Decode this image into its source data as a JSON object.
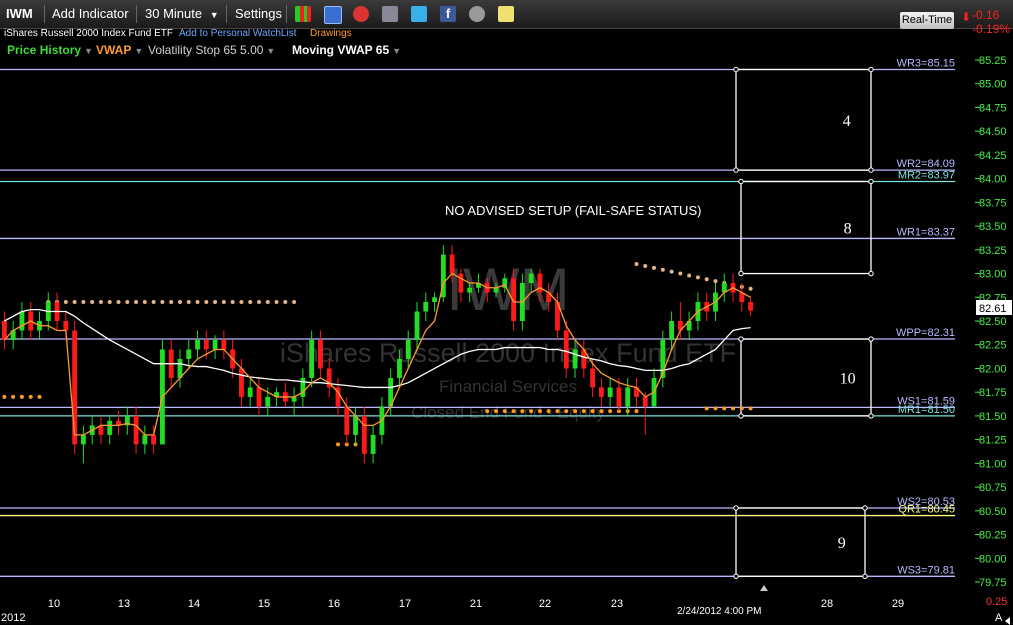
{
  "toolbar": {
    "symbol": "IWM",
    "add_indicator": "Add Indicator",
    "interval": "30 Minute",
    "settings": "Settings",
    "realtime_label": "Real-Time",
    "change": "-0.16",
    "change_pct": "-0.19%"
  },
  "subtitle": "iShares Russell 2000 Index Fund ETF",
  "watchlist_link": "Add to Personal WatchList",
  "drawings_link": "Drawings",
  "legend": [
    {
      "label": "Price History",
      "color": "#3cdc3c"
    },
    {
      "label": "VWAP",
      "color": "#ff9a30"
    },
    {
      "label": "Volatility Stop 65 5.00",
      "color": "#d0d0d0"
    },
    {
      "label": "Moving VWAP 65",
      "color": "#ffffff"
    }
  ],
  "annotation": "NO ADVISED SETUP (FAIL-SAFE STATUS)",
  "watermark": {
    "symbol": "IWM",
    "name": "iShares Russell 2000 Index Fund ETF",
    "sector": "Financial Services",
    "industry": "Closed End Fund - Equity"
  },
  "chart_data": {
    "type": "candlestick",
    "ylim": [
      79.75,
      85.25
    ],
    "y_ticks": [
      "85.25",
      "85.00",
      "84.75",
      "84.50",
      "84.25",
      "84.00",
      "83.75",
      "83.50",
      "83.25",
      "83.00",
      "82.75",
      "82.50",
      "82.25",
      "82.00",
      "81.75",
      "81.50",
      "81.25",
      "81.00",
      "80.75",
      "80.50",
      "80.25",
      "80.00",
      "79.75"
    ],
    "y_tick_step": 0.25,
    "x_labels": [
      "10",
      "13",
      "14",
      "15",
      "16",
      "17",
      "21",
      "22",
      "23",
      "28",
      "29"
    ],
    "last_bar_time": "2/24/2012 4:00 PM",
    "year_label": "2012",
    "last_price": "82.61",
    "last_price_value": 82.61,
    "scale_flag": "0.25",
    "scale_mode": "A",
    "pivot_levels": [
      {
        "label": "WR3=85.15",
        "value": 85.15,
        "color": "#b9b9ff"
      },
      {
        "label": "WR2=84.09",
        "value": 84.09,
        "color": "#b9b9ff"
      },
      {
        "label": "MR2=83.97",
        "value": 83.97,
        "color": "#7fe0e0"
      },
      {
        "label": "WR1=83.37",
        "value": 83.37,
        "color": "#b9b9ff"
      },
      {
        "label": "WPP=82.31",
        "value": 82.31,
        "color": "#b9b9ff"
      },
      {
        "label": "WS1=81.59",
        "value": 81.59,
        "color": "#b9b9ff"
      },
      {
        "label": "MR1=81.50",
        "value": 81.5,
        "color": "#7fe0e0"
      },
      {
        "label": "WS2=80.53",
        "value": 80.53,
        "color": "#b9b9ff"
      },
      {
        "label": "QR1=80.45",
        "value": 80.45,
        "color": "#ffff80"
      },
      {
        "label": "WS3=79.81",
        "value": 79.81,
        "color": "#b9b9ff"
      }
    ],
    "zones": [
      {
        "num": "4",
        "top": 85.15,
        "bottom": 84.09
      },
      {
        "num": "8",
        "top": 83.97,
        "bottom": 83.0
      },
      {
        "num": "10",
        "top": 82.31,
        "bottom": 81.5
      },
      {
        "num": "9",
        "top": 80.53,
        "bottom": 79.81
      }
    ],
    "candles": [
      [
        82.5,
        82.6,
        82.2,
        82.3
      ],
      [
        82.3,
        82.5,
        82.2,
        82.4
      ],
      [
        82.4,
        82.7,
        82.3,
        82.6
      ],
      [
        82.6,
        82.7,
        82.3,
        82.4
      ],
      [
        82.4,
        82.6,
        82.3,
        82.5
      ],
      [
        82.5,
        82.8,
        82.4,
        82.7
      ],
      [
        82.7,
        82.8,
        82.4,
        82.5
      ],
      [
        82.5,
        82.6,
        82.3,
        82.4
      ],
      [
        82.4,
        82.5,
        81.1,
        81.2
      ],
      [
        81.2,
        81.4,
        81.0,
        81.3
      ],
      [
        81.3,
        81.5,
        81.2,
        81.4
      ],
      [
        81.4,
        81.5,
        81.2,
        81.3
      ],
      [
        81.3,
        81.5,
        81.2,
        81.45
      ],
      [
        81.45,
        81.55,
        81.3,
        81.4
      ],
      [
        81.4,
        81.6,
        81.3,
        81.5
      ],
      [
        81.5,
        81.6,
        81.1,
        81.2
      ],
      [
        81.2,
        81.4,
        81.1,
        81.3
      ],
      [
        81.3,
        81.4,
        81.1,
        81.2
      ],
      [
        81.2,
        82.3,
        81.2,
        82.2
      ],
      [
        82.2,
        82.3,
        81.8,
        81.9
      ],
      [
        81.9,
        82.2,
        81.8,
        82.1
      ],
      [
        82.1,
        82.3,
        82.0,
        82.2
      ],
      [
        82.2,
        82.4,
        82.1,
        82.3
      ],
      [
        82.3,
        82.4,
        82.1,
        82.2
      ],
      [
        82.2,
        82.35,
        82.1,
        82.3
      ],
      [
        82.3,
        82.4,
        82.1,
        82.2
      ],
      [
        82.2,
        82.3,
        81.9,
        82.0
      ],
      [
        82.0,
        82.1,
        81.6,
        81.7
      ],
      [
        81.7,
        81.9,
        81.6,
        81.8
      ],
      [
        81.8,
        81.9,
        81.5,
        81.6
      ],
      [
        81.6,
        81.8,
        81.5,
        81.7
      ],
      [
        81.7,
        81.8,
        81.6,
        81.75
      ],
      [
        81.75,
        81.85,
        81.6,
        81.65
      ],
      [
        81.65,
        81.8,
        81.5,
        81.7
      ],
      [
        81.7,
        82.0,
        81.6,
        81.9
      ],
      [
        81.9,
        82.4,
        81.8,
        82.3
      ],
      [
        82.3,
        82.4,
        81.9,
        82.0
      ],
      [
        82.0,
        82.1,
        81.7,
        81.8
      ],
      [
        81.8,
        81.9,
        81.5,
        81.6
      ],
      [
        81.6,
        81.7,
        81.2,
        81.3
      ],
      [
        81.3,
        81.6,
        81.2,
        81.5
      ],
      [
        81.5,
        81.6,
        81.0,
        81.1
      ],
      [
        81.1,
        81.4,
        81.0,
        81.3
      ],
      [
        81.3,
        81.7,
        81.2,
        81.6
      ],
      [
        81.6,
        82.0,
        81.5,
        81.9
      ],
      [
        81.9,
        82.2,
        81.8,
        82.1
      ],
      [
        82.1,
        82.4,
        82.0,
        82.3
      ],
      [
        82.3,
        82.7,
        82.2,
        82.6
      ],
      [
        82.6,
        82.8,
        82.5,
        82.7
      ],
      [
        82.7,
        82.8,
        82.6,
        82.75
      ],
      [
        82.75,
        83.3,
        82.7,
        83.2
      ],
      [
        83.2,
        83.3,
        82.9,
        83.0
      ],
      [
        83.0,
        83.05,
        82.7,
        82.8
      ],
      [
        82.8,
        82.9,
        82.7,
        82.85
      ],
      [
        82.85,
        83.0,
        82.8,
        82.9
      ],
      [
        82.9,
        82.95,
        82.7,
        82.8
      ],
      [
        82.8,
        82.9,
        82.75,
        82.85
      ],
      [
        82.85,
        83.0,
        82.8,
        82.95
      ],
      [
        82.95,
        83.05,
        82.4,
        82.5
      ],
      [
        82.5,
        83.0,
        82.4,
        82.9
      ],
      [
        82.9,
        83.05,
        82.8,
        83.0
      ],
      [
        83.0,
        83.05,
        82.7,
        82.8
      ],
      [
        82.8,
        82.9,
        82.6,
        82.7
      ],
      [
        82.7,
        82.8,
        82.3,
        82.4
      ],
      [
        82.4,
        82.5,
        81.9,
        82.0
      ],
      [
        82.0,
        82.3,
        81.9,
        82.2
      ],
      [
        82.2,
        82.3,
        81.9,
        82.0
      ],
      [
        82.0,
        82.1,
        81.7,
        81.8
      ],
      [
        81.8,
        81.9,
        81.6,
        81.7
      ],
      [
        81.7,
        81.9,
        81.6,
        81.8
      ],
      [
        81.8,
        81.9,
        81.55,
        81.6
      ],
      [
        81.6,
        81.9,
        81.5,
        81.8
      ],
      [
        81.8,
        81.9,
        81.6,
        81.7
      ],
      [
        81.7,
        81.75,
        81.3,
        81.6
      ],
      [
        81.6,
        82.0,
        81.6,
        81.9
      ],
      [
        81.9,
        82.4,
        81.8,
        82.3
      ],
      [
        82.3,
        82.6,
        82.2,
        82.5
      ],
      [
        82.5,
        82.7,
        82.3,
        82.4
      ],
      [
        82.4,
        82.6,
        82.3,
        82.5
      ],
      [
        82.5,
        82.8,
        82.4,
        82.7
      ],
      [
        82.7,
        82.8,
        82.5,
        82.6
      ],
      [
        82.6,
        82.9,
        82.5,
        82.8
      ],
      [
        82.8,
        83.0,
        82.7,
        82.9
      ],
      [
        82.9,
        83.0,
        82.7,
        82.8
      ],
      [
        82.8,
        82.9,
        82.6,
        82.7
      ],
      [
        82.7,
        82.75,
        82.55,
        82.61
      ]
    ],
    "vwap": [
      82.3,
      82.4,
      82.45,
      82.5,
      82.45,
      82.45,
      82.4,
      82.4,
      81.3,
      81.3,
      81.35,
      81.4,
      81.4,
      81.4,
      81.42,
      81.4,
      81.3,
      81.3,
      81.7,
      81.8,
      81.9,
      82.0,
      82.1,
      82.15,
      82.2,
      82.2,
      82.1,
      82.0,
      81.9,
      81.8,
      81.75,
      81.7,
      81.7,
      81.7,
      81.75,
      81.85,
      81.9,
      81.85,
      81.75,
      81.6,
      81.5,
      81.4,
      81.4,
      81.45,
      81.6,
      81.8,
      82.0,
      82.2,
      82.4,
      82.5,
      82.9,
      83.0,
      82.95,
      82.9,
      82.9,
      82.85,
      82.85,
      82.88,
      82.7,
      82.7,
      82.8,
      82.85,
      82.8,
      82.7,
      82.45,
      82.3,
      82.2,
      82.05,
      81.95,
      81.9,
      81.85,
      81.82,
      81.8,
      81.7,
      81.75,
      81.95,
      82.2,
      82.4,
      82.5,
      82.6,
      82.65,
      82.7,
      82.8,
      82.85,
      82.8,
      82.75
    ],
    "moving_vwap": [
      82.5,
      82.55,
      82.6,
      82.62,
      82.62,
      82.6,
      82.6,
      82.6,
      82.55,
      82.48,
      82.42,
      82.36,
      82.3,
      82.25,
      82.2,
      82.15,
      82.1,
      82.05,
      82.05,
      82.05,
      82.05,
      82.03,
      82.02,
      82.02,
      82.0,
      81.98,
      81.95,
      81.93,
      81.91,
      81.9,
      81.89,
      81.88,
      81.88,
      81.87,
      81.86,
      81.85,
      81.85,
      81.84,
      81.83,
      81.82,
      81.81,
      81.8,
      81.8,
      81.8,
      81.8,
      81.82,
      81.85,
      81.9,
      81.95,
      82.0,
      82.05,
      82.1,
      82.15,
      82.18,
      82.2,
      82.2,
      82.2,
      82.22,
      82.22,
      82.22,
      82.22,
      82.22,
      82.2,
      82.2,
      82.18,
      82.15,
      82.12,
      82.1,
      82.08,
      82.05,
      82.03,
      82.02,
      82.0,
      81.98,
      81.98,
      81.98,
      82.0,
      82.03,
      82.05,
      82.1,
      82.15,
      82.2,
      82.3,
      82.4,
      82.42,
      82.43
    ],
    "volatility_stop": [
      {
        "from": 5,
        "to": 33,
        "value": 82.7
      },
      {
        "from": 0,
        "to": 4,
        "value": 81.7
      },
      {
        "from": 55,
        "to": 72,
        "value": 81.55
      },
      {
        "from": 72,
        "to": 85,
        "value": 83.1
      },
      {
        "from": 80,
        "to": 85,
        "value": 81.58
      },
      {
        "from": 38,
        "to": 42,
        "value": 81.2
      }
    ]
  }
}
